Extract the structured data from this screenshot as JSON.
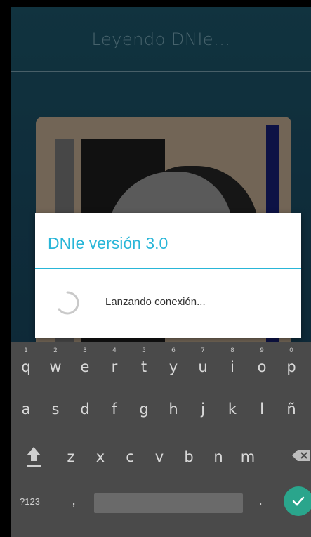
{
  "app": {
    "title": "Leyendo DNIe..."
  },
  "dialog": {
    "title": "DNIe versión 3.0",
    "message": "Lanzando conexión..."
  },
  "keyboard": {
    "row1": [
      {
        "hint": "1",
        "key": "q"
      },
      {
        "hint": "2",
        "key": "w"
      },
      {
        "hint": "3",
        "key": "e"
      },
      {
        "hint": "4",
        "key": "r"
      },
      {
        "hint": "5",
        "key": "t"
      },
      {
        "hint": "6",
        "key": "y"
      },
      {
        "hint": "7",
        "key": "u"
      },
      {
        "hint": "8",
        "key": "i"
      },
      {
        "hint": "9",
        "key": "o"
      },
      {
        "hint": "0",
        "key": "p"
      }
    ],
    "row2": [
      "a",
      "s",
      "d",
      "f",
      "g",
      "h",
      "j",
      "k",
      "l",
      "ñ"
    ],
    "row3": [
      "z",
      "x",
      "c",
      "v",
      "b",
      "n",
      "m"
    ],
    "symbols_label": "?123",
    "comma": ",",
    "period": "."
  },
  "colors": {
    "accent": "#29b6d8",
    "keyboard_bg": "#4a4a4a",
    "enter_key": "#2aa58c"
  }
}
